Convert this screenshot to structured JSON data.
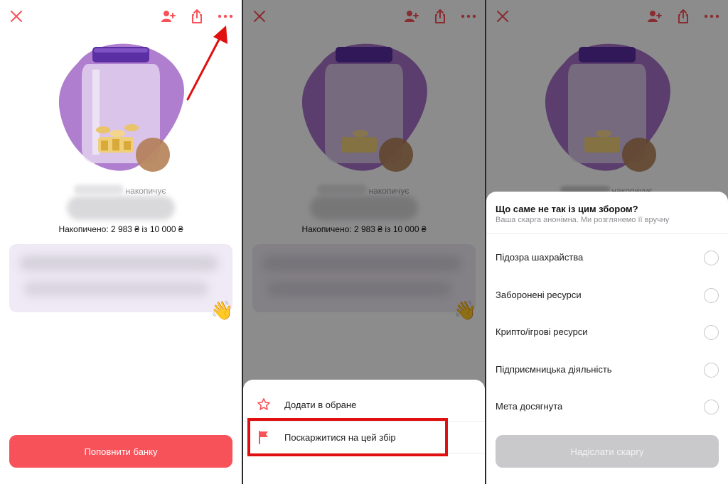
{
  "colors": {
    "accent": "#f7525a",
    "annotation_red": "#e01010",
    "jar_blob": "#a672c8",
    "disabled_button": "#c9c9cc"
  },
  "icons": {
    "close": "close-icon",
    "add_user": "add-user-icon",
    "share": "share-icon",
    "more": "more-icon",
    "favorite": "star-icon",
    "report": "flag-icon",
    "wave": "waving-hand-emoji"
  },
  "jar": {
    "status_label": "накопичує",
    "accumulated_text": "Накопичено: 2 983 ₴ із 10 000 ₴",
    "amount_collected": 2983,
    "amount_goal": 10000,
    "wave_emoji": "👋",
    "cta_label": "Поповнити банку"
  },
  "menu_sheet": {
    "items": [
      {
        "label": "Додати в обране",
        "icon": "star-icon"
      },
      {
        "label": "Поскаржитися на цей збір",
        "icon": "flag-icon"
      }
    ]
  },
  "report_sheet": {
    "title": "Що саме не так із цим збором?",
    "subtitle": "Ваша скарга анонімна. Ми розглянемо її вручну",
    "options": [
      "Підозра шахрайства",
      "Заборонені ресурси",
      "Крипто/ігрові ресурси",
      "Підприємницька діяльність",
      "Мета досягнута"
    ],
    "submit_label": "Надіслати скаргу"
  }
}
